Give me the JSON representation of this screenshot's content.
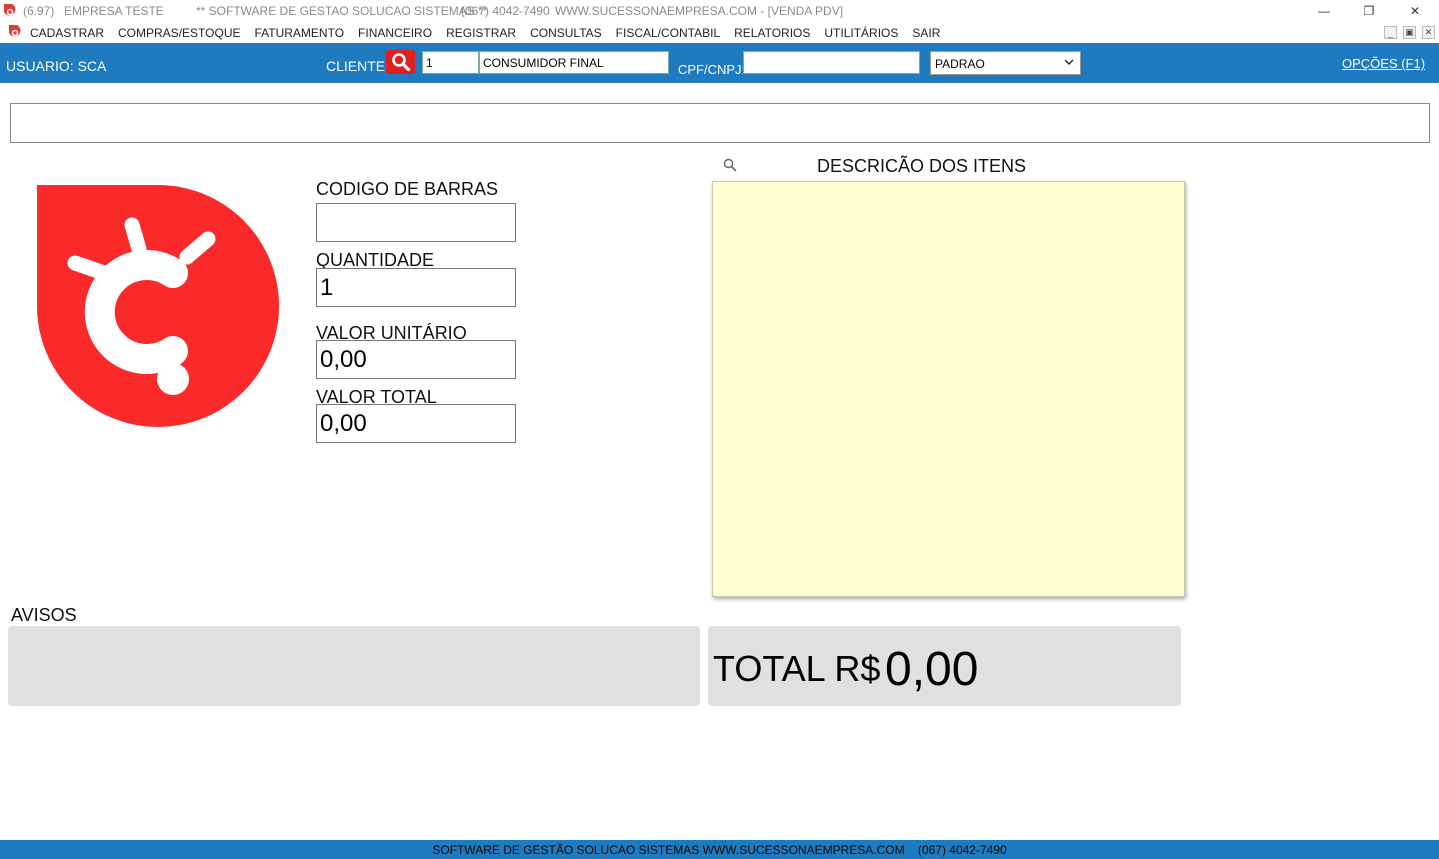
{
  "titlebar": {
    "version": "(6.97)",
    "company": "EMPRESA TESTE",
    "software": "** SOFTWARE DE GESTAO SOLUCAO SISTEMAS **",
    "phone": "(067) 4042-7490",
    "site": "WWW.SUCESSONAEMPRESA.COM - [VENDA PDV]",
    "minimize_glyph": "—",
    "restore_glyph": "❐",
    "close_glyph": "✕"
  },
  "menu": {
    "items": [
      "CADASTRAR",
      "COMPRAS/ESTOQUE",
      "FATURAMENTO",
      "FINANCEIRO",
      "REGISTRAR",
      "CONSULTAS",
      "FISCAL/CONTABIL",
      "RELATORIOS",
      "UTILITÁRIOS",
      "SAIR"
    ],
    "mdi_min": "_",
    "mdi_restore": "▣",
    "mdi_close": "✕"
  },
  "header": {
    "user_label": "USUARIO: SCA",
    "client_label": "CLIENTE:",
    "client_code": "1",
    "client_name": "CONSUMIDOR FINAL",
    "cpf_label": "CPF/CNPJ:",
    "cpf_value": "",
    "price_table": "PADRAO",
    "options_label": "OPÇÕES (F1)"
  },
  "form": {
    "barcode_label": "CODIGO DE BARRAS",
    "barcode_value": "",
    "quantity_label": "QUANTIDADE",
    "quantity_value": "1",
    "unit_value_label": "VALOR UNITÁRIO",
    "unit_value": "0,00",
    "total_value_label": "VALOR TOTAL",
    "total_value": "0,00"
  },
  "items": {
    "title": "DESCRICÃO DOS ITENS"
  },
  "avisos": {
    "label": "AVISOS"
  },
  "totals": {
    "label": "TOTAL R$",
    "value": "0,00"
  },
  "statusbar": {
    "text": "SOFTWARE DE GESTÃO SOLUCAO SISTEMAS WWW.SUCESSONAEMPRESA.COM    (067) 4042-7490"
  },
  "colors": {
    "accent_blue": "#1e7bbf",
    "brand_red": "#fb2a2a",
    "items_panel": "#ffffd4",
    "panel_gray": "#e0e0e0"
  },
  "icons": {
    "app": "app-logo-icon",
    "search": "search-icon",
    "chevron": "chevron-down-icon",
    "logo": "brand-logo"
  }
}
